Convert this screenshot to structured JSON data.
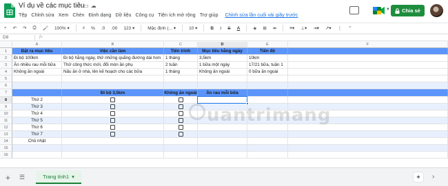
{
  "app": {
    "doc_title": "Ví dụ về các mục tiêu",
    "menu": [
      "Tệp",
      "Chỉnh sửa",
      "Xem",
      "Chèn",
      "Định dạng",
      "Dữ liệu",
      "Công cụ",
      "Tiện ích mở rộng",
      "Trợ giúp"
    ],
    "last_edit": "Chỉnh sửa lần cuối vài giây trước",
    "share_label": "Chia sẻ",
    "share_icon": "lock-icon",
    "brand_color": "#1e8e3e"
  },
  "toolbar": {
    "zoom": "100%",
    "currency": "₫",
    "percent": "%",
    "dec_less": ".0",
    "dec_more": ".00",
    "format_more": "123",
    "font": "Mặc định (...",
    "font_size": "10",
    "bold": "B",
    "italic": "I",
    "strike": "S",
    "text_color": "A"
  },
  "formula_bar": {
    "cell_ref": "D8",
    "fx": "fx"
  },
  "columns": [
    "A",
    "B",
    "C",
    "D",
    "E",
    "F"
  ],
  "selected_column": "D",
  "selected_row": "8",
  "rows": [
    {
      "num": "1",
      "cells": [
        "Đặt ra mục tiêu",
        "Việc cần làm",
        "Tiến trình",
        "Mục tiêu hằng ngày",
        "Tiến độ",
        ""
      ]
    },
    {
      "num": "2",
      "cells": [
        "Đi bộ 100km",
        "Đi bộ hằng ngày, thử những quãng đường dài hơn",
        "1 tháng",
        "3,5km",
        "10km",
        ""
      ]
    },
    {
      "num": "3",
      "cells": [
        "Ăn nhiều rau mỗi bữa",
        "Thử công thức mới, đổi món ăn phụ",
        "2 tuần",
        "1 bữa một ngày",
        "17/21 bữa, tuần 1",
        ""
      ]
    },
    {
      "num": "4",
      "cells": [
        "Không ăn ngoài",
        "Nấu ăn ở nhà, lên kế hoạch cho các bữa",
        "1 tháng",
        "Không ăn ngoài",
        "0 bữa ăn ngoài",
        ""
      ]
    },
    {
      "num": "5",
      "cells": [
        "",
        "",
        "",
        "",
        "",
        ""
      ]
    },
    {
      "num": "6",
      "cells": [
        "",
        "",
        "",
        "",
        "",
        ""
      ]
    },
    {
      "num": "7",
      "cells": [
        "",
        "Đi bộ 3,5km",
        "Không ăn ngoài",
        "Ăn rau mỗi bữa",
        "",
        ""
      ]
    },
    {
      "num": "8",
      "cells": [
        "Thứ 2",
        "",
        "",
        "",
        "",
        ""
      ]
    },
    {
      "num": "9",
      "cells": [
        "Thứ 3",
        "",
        "",
        "",
        "",
        ""
      ]
    },
    {
      "num": "10",
      "cells": [
        "Thứ 4",
        "",
        "",
        "",
        "",
        ""
      ]
    },
    {
      "num": "11",
      "cells": [
        "Thứ 5",
        "",
        "",
        "",
        "",
        ""
      ]
    },
    {
      "num": "12",
      "cells": [
        "Thứ 6",
        "",
        "",
        "",
        "",
        ""
      ]
    },
    {
      "num": "13",
      "cells": [
        "Thứ 7",
        "",
        "",
        "",
        "",
        ""
      ]
    },
    {
      "num": "14",
      "cells": [
        "Chủ nhật",
        "",
        "",
        "",
        "",
        ""
      ]
    },
    {
      "num": "15",
      "cells": [
        "",
        "",
        "",
        "",
        "",
        ""
      ]
    },
    {
      "num": "16",
      "cells": [
        "",
        "",
        "",
        "",
        "",
        ""
      ]
    }
  ],
  "header_rows": [
    "1",
    "7"
  ],
  "checkbox_rows": [
    "8",
    "9",
    "10",
    "11",
    "12",
    "13"
  ],
  "header_color": "#5b95f9",
  "alt_row_color": "#e8f0fe",
  "watermark": "uantrimang",
  "sheet_tab": "Trang tính1"
}
